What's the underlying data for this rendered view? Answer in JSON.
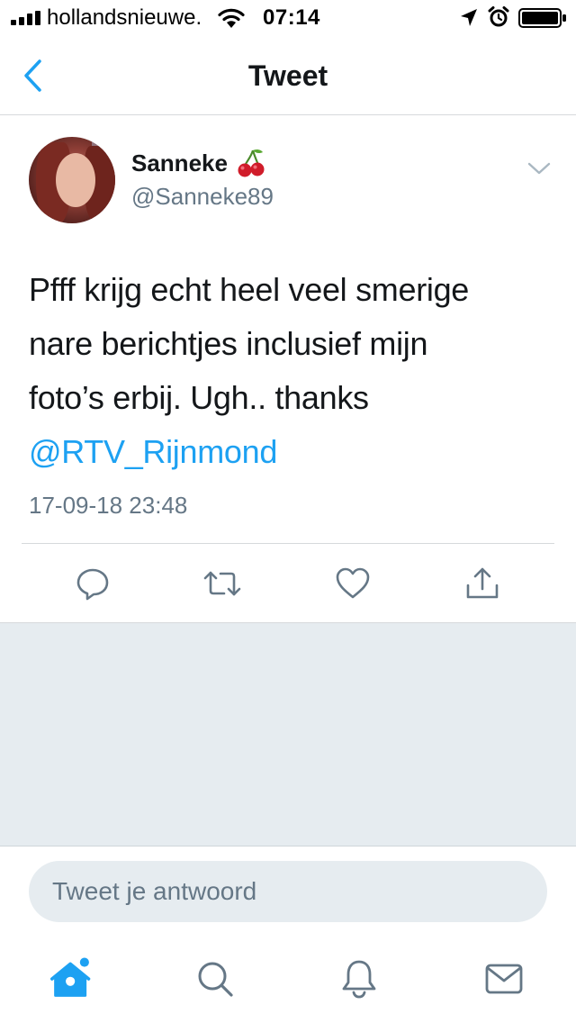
{
  "status_bar": {
    "carrier": "hollandsnieuwe.",
    "time": "07:14"
  },
  "nav": {
    "title": "Tweet",
    "back_icon": "chevron-left-icon"
  },
  "tweet": {
    "author_name": "Sanneke",
    "author_handle": "@Sanneke89",
    "name_emoji_icon": "cherries-icon",
    "text_lines": [
      "Pfff krijg echt heel veel smerige",
      "nare berichtjes inclusief mijn",
      "foto’s erbij. Ugh.. thanks"
    ],
    "mention": "@RTV_Rijnmond",
    "timestamp": "17-09-18 23:48",
    "actions": [
      "reply-icon",
      "retweet-icon",
      "like-icon",
      "share-icon"
    ]
  },
  "reply": {
    "placeholder": "Tweet je antwoord"
  },
  "tab_bar": {
    "tabs": [
      "home-icon",
      "search-icon",
      "notifications-icon",
      "messages-icon"
    ],
    "home_has_badge_dot": true
  },
  "colors": {
    "accent": "#1da1f2",
    "text_primary": "#14171a",
    "text_secondary": "#657786",
    "background_gray": "#e6ecf0",
    "divider": "#d6d9dc"
  }
}
